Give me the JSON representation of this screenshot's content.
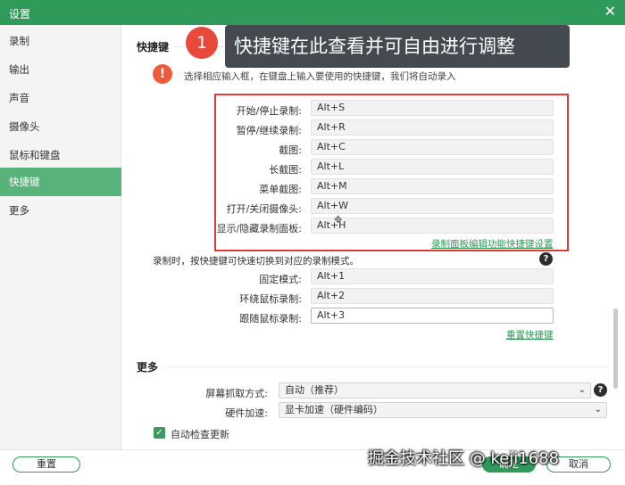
{
  "window": {
    "title": "设置",
    "close_glyph": "✕"
  },
  "sidebar": {
    "items": [
      {
        "label": "录制"
      },
      {
        "label": "输出"
      },
      {
        "label": "声音"
      },
      {
        "label": "摄像头"
      },
      {
        "label": "鼠标和键盘"
      },
      {
        "label": "快捷键",
        "active": true
      },
      {
        "label": "更多"
      }
    ]
  },
  "hotkeys": {
    "title": "快捷键",
    "annotation_number": "1",
    "annotation_text": "快捷键在此查看并可自由进行调整",
    "warn_glyph": "!",
    "description": "选择相应输入框，在键盘上输入要使用的快捷键，我们将自动录入",
    "rows": [
      {
        "label": "开始/停止录制:",
        "value": "Alt+S"
      },
      {
        "label": "暂停/继续录制:",
        "value": "Alt+R"
      },
      {
        "label": "截图:",
        "value": "Alt+C"
      },
      {
        "label": "长截图:",
        "value": "Alt+L"
      },
      {
        "label": "菜单截图:",
        "value": "Alt+M"
      },
      {
        "label": "打开/关闭摄像头:",
        "value": "Alt+W"
      },
      {
        "label": "显示/隐藏录制面板:",
        "value": "Alt+H"
      }
    ],
    "panel_link": "录制面板编辑功能快捷键设置",
    "mode_note": "录制时，按快捷键可快速切换到对应的录制模式。",
    "mode_rows": [
      {
        "label": "固定模式:",
        "value": "Alt+1"
      },
      {
        "label": "环绕鼠标录制:",
        "value": "Alt+2"
      },
      {
        "label": "跟随鼠标录制:",
        "value": "Alt+3"
      }
    ],
    "reset_link": "重置快捷键",
    "help_glyph": "?"
  },
  "more": {
    "title": "更多",
    "capture_label": "屏幕抓取方式:",
    "capture_value": "自动（推荐）",
    "accel_label": "硬件加速:",
    "accel_value": "显卡加速（硬件编码）",
    "auto_update_label": "自动检查更新",
    "auto_update_checked": true,
    "chevron": "⌄",
    "check_glyph": "✓"
  },
  "footer": {
    "reset_button": "重置",
    "ok_button": "确定",
    "cancel_button": "取消"
  },
  "watermark": "掘金技术社区 @ keji1688"
}
